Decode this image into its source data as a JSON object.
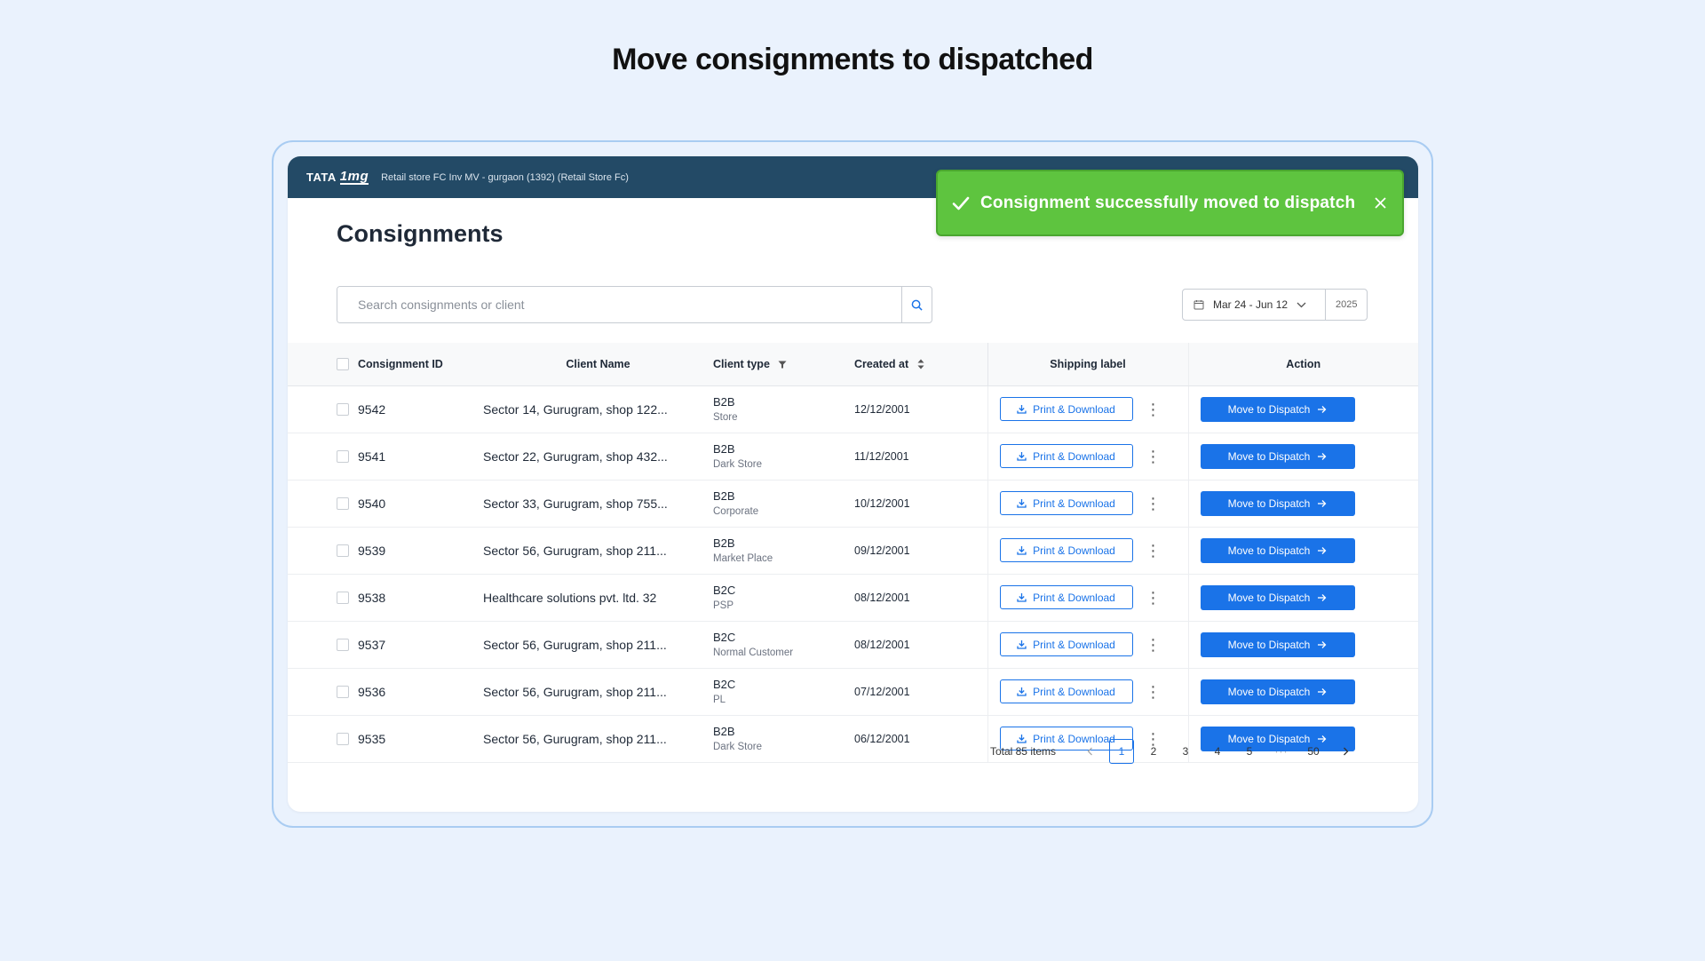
{
  "page_heading": "Move consignments to dispatched",
  "topbar": {
    "brand": "TATA",
    "brand_suffix": "1mg",
    "store": "Retail store FC Inv MV - gurgaon (1392) (Retail Store Fc)"
  },
  "title": "Consignments",
  "search": {
    "placeholder": "Search consignments or client"
  },
  "date_filter": {
    "range": "Mar 24 - Jun 12",
    "year": "2025"
  },
  "toast": {
    "message": "Consignment successfully moved to dispatch"
  },
  "columns": {
    "id": "Consignment ID",
    "client": "Client Name",
    "type": "Client type",
    "created": "Created at",
    "label": "Shipping label",
    "action": "Action"
  },
  "rows": [
    {
      "id": "9542",
      "client": "Sector 14, Gurugram, shop 122...",
      "type": "B2B",
      "subtype": "Store",
      "created": "12/12/2001",
      "print": "Print & Download",
      "action": "Move to Dispatch"
    },
    {
      "id": "9541",
      "client": "Sector 22, Gurugram, shop 432...",
      "type": "B2B",
      "subtype": "Dark Store",
      "created": "11/12/2001",
      "print": "Print & Download",
      "action": "Move to Dispatch"
    },
    {
      "id": "9540",
      "client": "Sector 33, Gurugram, shop 755...",
      "type": "B2B",
      "subtype": "Corporate",
      "created": "10/12/2001",
      "print": "Print & Download",
      "action": "Move to Dispatch"
    },
    {
      "id": "9539",
      "client": "Sector 56, Gurugram, shop 211...",
      "type": "B2B",
      "subtype": "Market Place",
      "created": "09/12/2001",
      "print": "Print & Download",
      "action": "Move to Dispatch"
    },
    {
      "id": "9538",
      "client": "Healthcare solutions pvt. ltd. 32",
      "type": "B2C",
      "subtype": "PSP",
      "created": "08/12/2001",
      "print": "Print & Download",
      "action": "Move to Dispatch"
    },
    {
      "id": "9537",
      "client": "Sector 56, Gurugram, shop 211...",
      "type": "B2C",
      "subtype": "Normal Customer",
      "created": "08/12/2001",
      "print": "Print & Download",
      "action": "Move to Dispatch"
    },
    {
      "id": "9536",
      "client": "Sector 56, Gurugram, shop 211...",
      "type": "B2C",
      "subtype": "PL",
      "created": "07/12/2001",
      "print": "Print & Download",
      "action": "Move to Dispatch"
    },
    {
      "id": "9535",
      "client": "Sector 56, Gurugram, shop 211...",
      "type": "B2B",
      "subtype": "Dark Store",
      "created": "06/12/2001",
      "print": "Print & Download",
      "action": "Move to Dispatch"
    }
  ],
  "pagination": {
    "total": "Total 85 items",
    "pages": [
      "1",
      "2",
      "3",
      "4",
      "5"
    ],
    "ellipsis": "···",
    "last": "50",
    "current": "1"
  },
  "colors": {
    "primary": "#1a73e8",
    "topbar": "#234a66",
    "toast": "#5ec43f",
    "background": "#eaf2fd"
  }
}
